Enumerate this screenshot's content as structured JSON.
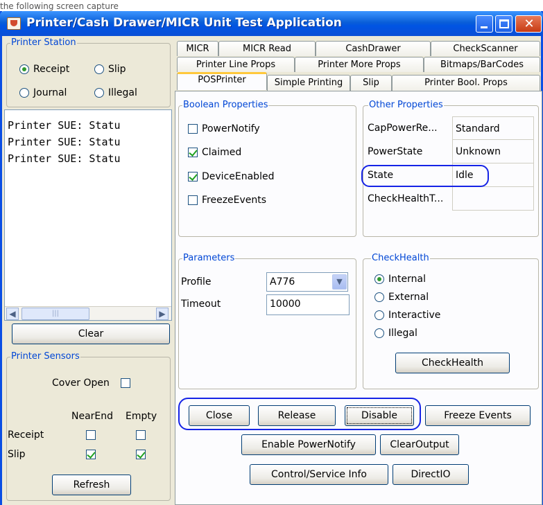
{
  "window": {
    "title": "Printer/Cash Drawer/MICR Unit Test Application",
    "above_fragment": "the following screen capture"
  },
  "printer_station": {
    "title": "Printer Station",
    "options": [
      "Receipt",
      "Slip",
      "Journal",
      "Illegal"
    ],
    "selected": "Receipt"
  },
  "log": {
    "lines": [
      "Printer SUE: Statu",
      "Printer SUE: Statu",
      "Printer SUE: Statu"
    ],
    "clear_label": "Clear"
  },
  "printer_sensors": {
    "title": "Printer Sensors",
    "cover_open_label": "Cover Open",
    "cover_open_checked": false,
    "headers": [
      "NearEnd",
      "Empty"
    ],
    "rows": [
      {
        "label": "Receipt",
        "nearend": false,
        "empty": false
      },
      {
        "label": "Slip",
        "nearend": true,
        "empty": true
      }
    ],
    "refresh_label": "Refresh"
  },
  "tabs": {
    "row1": [
      "MICR",
      "MICR Read",
      "CashDrawer",
      "CheckScanner"
    ],
    "row2": [
      "Printer Line Props",
      "Printer More Props",
      "Bitmaps/BarCodes"
    ],
    "row3": [
      "POSPrinter",
      "Simple Printing",
      "Slip",
      "Printer Bool. Props"
    ],
    "selected": "POSPrinter"
  },
  "boolean_properties": {
    "title": "Boolean Properties",
    "items": [
      {
        "label": "PowerNotify",
        "checked": false
      },
      {
        "label": "Claimed",
        "checked": true
      },
      {
        "label": "DeviceEnabled",
        "checked": true
      },
      {
        "label": "FreezeEvents",
        "checked": false
      }
    ]
  },
  "other_properties": {
    "title": "Other Properties",
    "rows": [
      {
        "name": "CapPowerRe...",
        "value": "Standard"
      },
      {
        "name": "PowerState",
        "value": "Unknown"
      },
      {
        "name": "State",
        "value": "Idle"
      },
      {
        "name": "CheckHealthT...",
        "value": ""
      }
    ]
  },
  "parameters": {
    "title": "Parameters",
    "profile_label": "Profile",
    "profile_value": "A776",
    "timeout_label": "Timeout",
    "timeout_value": "10000"
  },
  "check_health": {
    "title": "CheckHealth",
    "options": [
      "Internal",
      "External",
      "Interactive",
      "Illegal"
    ],
    "selected": "Internal",
    "button_label": "CheckHealth"
  },
  "actions": {
    "close": "Close",
    "release": "Release",
    "disable": "Disable",
    "freeze_events": "Freeze Events",
    "enable_power_notify": "Enable PowerNotify",
    "clear_output": "ClearOutput",
    "control_service_info": "Control/Service Info",
    "direct_io": "DirectIO"
  },
  "colors": {
    "title_bar": "#0054e3",
    "group_label": "#0046d5",
    "highlight": "#1523e6",
    "window_bg": "#ece9d8"
  }
}
